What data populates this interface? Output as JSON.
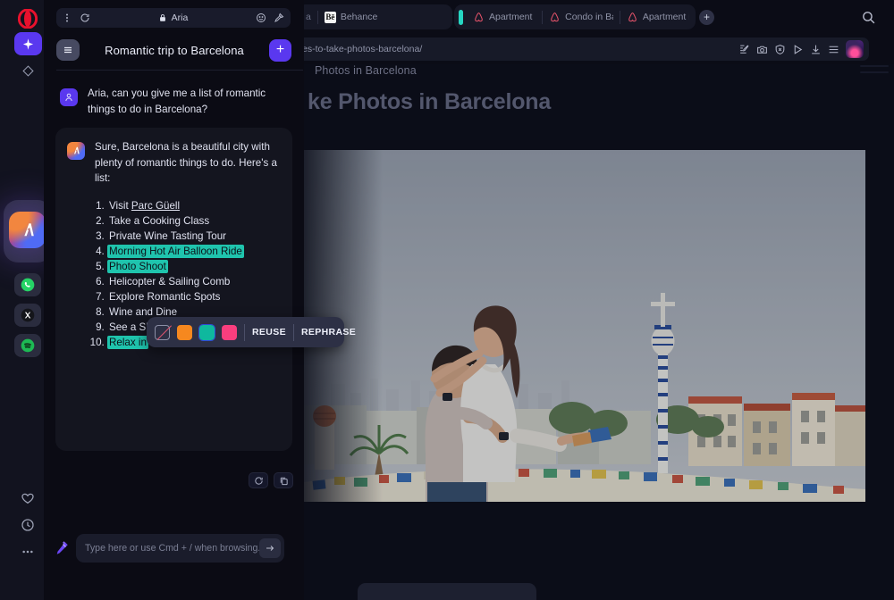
{
  "browser": {
    "tabs_partial_label": "a",
    "tabs": [
      {
        "label": "Behance",
        "favicon": "behance-icon"
      }
    ],
    "tab_group": {
      "indicator_color": "#26d6c2",
      "tabs": [
        {
          "label": "Apartment in Barce",
          "favicon": "airbnb-icon"
        },
        {
          "label": "Condo in Barcelona",
          "favicon": "airbnb-icon"
        },
        {
          "label": "Apartment in Barce",
          "favicon": "airbnb-icon"
        }
      ]
    },
    "new_tab_label": "+",
    "icons": {
      "tab_search": "search-icon",
      "address_icons": [
        "edit-note-icon",
        "camera-snapshot-icon",
        "shield-privacy-icon",
        "player-icon",
        "downloads-icon",
        "easy-setup-icon"
      ]
    },
    "url": "es-to-take-photos-barcelona/"
  },
  "page": {
    "breadcrumb": "Photos in Barcelona",
    "title": "ke Photos in Barcelona",
    "hero_alt": "couple-embracing-at-park-guell-barcelona"
  },
  "rail": {
    "logo": "opera-logo-icon",
    "top_items": [
      {
        "name": "aria-button",
        "icon": "sparkle-icon",
        "active": true
      },
      {
        "name": "workspace-button",
        "icon": "diamond-icon",
        "active": false
      }
    ],
    "apps": [
      {
        "name": "whatsapp",
        "icon": "whatsapp-icon",
        "color": "#25D366"
      },
      {
        "name": "x-twitter",
        "icon": "x-icon",
        "color": "#111111"
      },
      {
        "name": "spotify",
        "icon": "spotify-icon",
        "color": "#1DB954"
      }
    ],
    "bottom_items": [
      {
        "name": "bookmarks",
        "icon": "heart-icon"
      },
      {
        "name": "history",
        "icon": "clock-icon"
      },
      {
        "name": "more",
        "icon": "ellipsis-icon"
      }
    ]
  },
  "aria": {
    "titlebar": {
      "menu_icon": "kebab-menu-icon",
      "reload_icon": "reload-icon",
      "lock_icon": "lock-icon",
      "title": "Aria",
      "emoji_icon": "smiley-icon",
      "pin_icon": "pin-icon"
    },
    "header": {
      "menu_icon": "hamburger-icon",
      "chat_title": "Romantic trip to Barcelona",
      "new_chat_label": "+"
    },
    "messages": [
      {
        "role": "user",
        "avatar": "user-avatar-icon",
        "text": "Aria, can you give me a list of romantic things to do in Barcelona?"
      },
      {
        "role": "assistant",
        "avatar": "aria-logo-icon",
        "text": "Sure, Barcelona is a beautiful city with plenty of romantic things to do. Here's a list:"
      }
    ],
    "list_items": [
      {
        "n": 1,
        "text": "Visit Parc Güell",
        "style": "link",
        "highlight": false
      },
      {
        "n": 2,
        "text": "Take a Cooking Class",
        "style": "plain",
        "highlight": false
      },
      {
        "n": 3,
        "text": "Private Wine Tasting Tour",
        "style": "plain",
        "highlight": false
      },
      {
        "n": 4,
        "text": "Morning Hot Air Balloon Ride",
        "style": "plain",
        "highlight": true
      },
      {
        "n": 5,
        "text": "Photo Shoot",
        "style": "plain",
        "highlight": true
      },
      {
        "n": 6,
        "text": "Helicopter & Sailing Comb",
        "style": "plain",
        "highlight": false
      },
      {
        "n": 7,
        "text": "Explore Romantic Spots",
        "style": "plain",
        "highlight": false
      },
      {
        "n": 8,
        "text": "Wine and Dine",
        "style": "plain",
        "highlight": false
      },
      {
        "n": 9,
        "text": "See a Show",
        "style": "plain",
        "highlight": false
      },
      {
        "n": 10,
        "text": "Relax in",
        "style": "plain",
        "highlight": true
      }
    ],
    "message_actions": [
      {
        "name": "regenerate-button",
        "icon": "reload-icon"
      },
      {
        "name": "copy-button",
        "icon": "copy-icon"
      }
    ],
    "selection_toolbar": {
      "swatches": [
        {
          "name": "no-highlight",
          "color": "none"
        },
        {
          "name": "orange-highlight",
          "color": "#F6881F"
        },
        {
          "name": "teal-highlight",
          "color": "#0FB89E"
        },
        {
          "name": "pink-highlight",
          "color": "#F93E7E"
        }
      ],
      "reuse_label": "REUSE",
      "rephrase_label": "REPHRASE"
    },
    "composer": {
      "magic_icon": "magic-wand-icon",
      "placeholder": "Type here or use Cmd + / when browsing...",
      "value": "",
      "send_icon": "arrow-right-icon"
    }
  },
  "colors": {
    "accent_purple": "#5a38ef",
    "highlight_teal": "#1fc4ad",
    "opera_red": "#e8112d",
    "group_teal": "#26d6c2"
  }
}
